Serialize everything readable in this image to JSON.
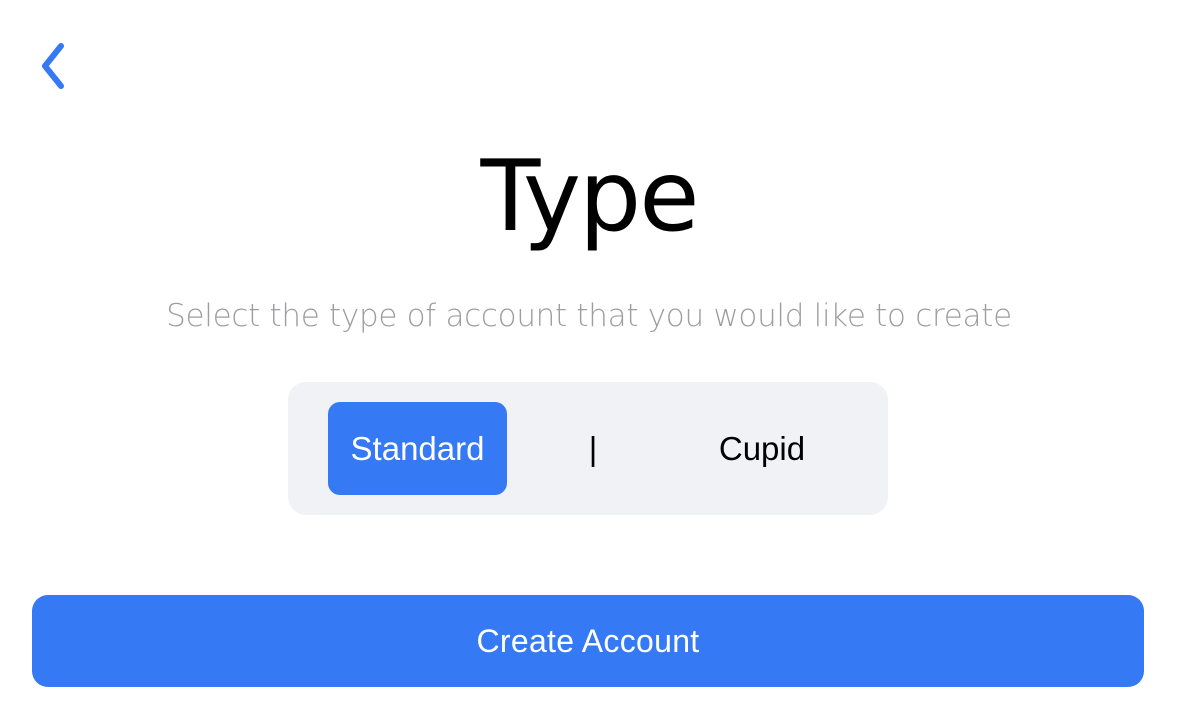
{
  "nav": {
    "back_icon": "chevron-left-icon"
  },
  "header": {
    "title": "Type",
    "subtitle": "Select the type of account that you would like to create"
  },
  "account_type": {
    "options": [
      {
        "label": "Standard",
        "selected": true
      },
      {
        "label": "Cupid",
        "selected": false
      }
    ],
    "separator": "|"
  },
  "actions": {
    "create_label": "Create Account"
  },
  "colors": {
    "accent": "#3579f5",
    "segment_background": "#f1f2f6",
    "subtitle_text": "#9d9da2",
    "title_text": "#000000"
  }
}
